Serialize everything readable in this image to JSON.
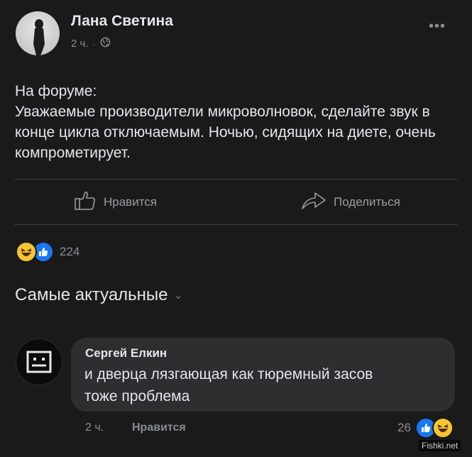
{
  "post": {
    "author": "Лана Светина",
    "time": "2 ч.",
    "privacy_icon": "globe-icon",
    "text": "На форуме:\nУважаемые производители микроволновок, сделайте звук в конце цикла отключаемым. Ночью, сидящих на диете, очень компрометирует.",
    "actions": {
      "like": "Нравится",
      "share": "Поделиться"
    },
    "reactions": {
      "icons": [
        "haha-icon",
        "like-icon"
      ],
      "count": "224"
    }
  },
  "comments": {
    "sort_label": "Самые актуальные",
    "items": [
      {
        "author": "Сергей Елкин",
        "text": "и дверца лязгающая как тюремный засов\nтоже проблема",
        "time": "2 ч.",
        "like_label": "Нравится",
        "reaction_count": "26",
        "reaction_icons": [
          "like-icon",
          "haha-icon"
        ]
      }
    ]
  },
  "watermark": "Fishki.net",
  "colors": {
    "background": "#1a1a1b",
    "text": "#e4e6eb",
    "secondary": "#8a8d91",
    "bubble": "#2d2e30",
    "like_blue": "#1877f2",
    "haha_yellow": "#f7c531"
  }
}
